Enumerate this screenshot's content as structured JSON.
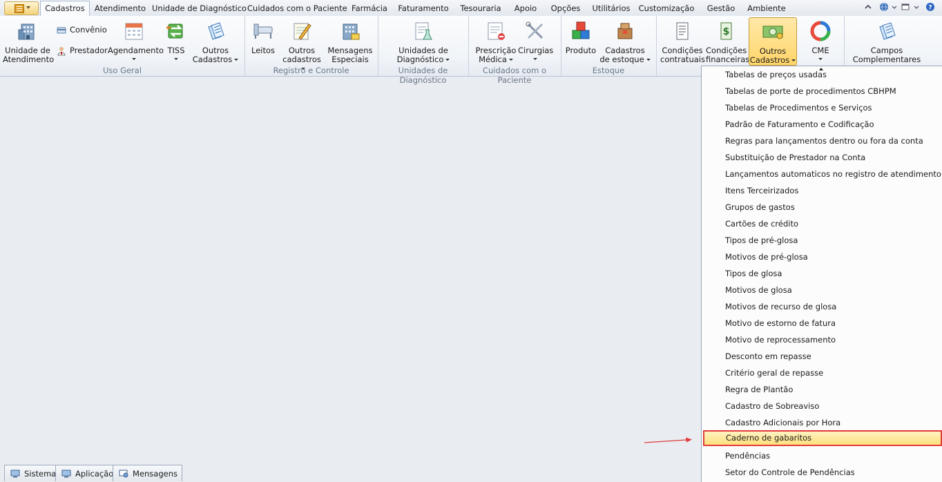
{
  "menu_tabs": [
    {
      "label": "Cadastros",
      "active": true
    },
    {
      "label": "Atendimento"
    },
    {
      "label": "Unidade de Diagnóstico"
    },
    {
      "label": "Cuidados com o Paciente"
    },
    {
      "label": "Farmácia"
    },
    {
      "label": "Faturamento"
    },
    {
      "label": "Tesouraria"
    },
    {
      "label": "Apoio"
    },
    {
      "label": "Opções"
    },
    {
      "label": "Utilitários"
    },
    {
      "label": "Customização"
    },
    {
      "label": "Gestão"
    },
    {
      "label": "Ambiente"
    }
  ],
  "ribbon": {
    "uso_geral": {
      "group_label": "Uso Geral",
      "unidade_atendimento": "Unidade de\nAtendimento",
      "convenio": "Convênio",
      "prestador": "Prestador",
      "agendamento": "Agendamento",
      "tiss": "TISS",
      "outros_cadastros": "Outros\nCadastros"
    },
    "registro_controle": {
      "group_label": "Registro e Controle",
      "leitos": "Leitos",
      "outros_cadastros": "Outros\ncadastros",
      "mensagens": "Mensagens\nEspeciais"
    },
    "unidades_diag": {
      "group_label": "Unidades de Diagnóstico",
      "unidades": "Unidades de\nDiagnóstico"
    },
    "cuidados": {
      "group_label": "Cuidados com o Paciente",
      "prescricao": "Prescrição\nMédica",
      "cirurgias": "Cirurgias"
    },
    "estoque": {
      "group_label": "Estoque",
      "produto": "Produto",
      "cadastros_estoque": "Cadastros\nde estoque"
    },
    "financeiro": {
      "condicoes_contratuais": "Condições\ncontratuais",
      "condicoes_financeiras": "Condições\nfinanceiras",
      "outros_cadastros": "Outros\nCadastros",
      "cme": "CME",
      "campos": "Campos\nComplementares"
    }
  },
  "dropdown": {
    "items": [
      "Tabelas de preços usadas",
      "Tabelas de porte de procedimentos CBHPM",
      "Tabelas de Procedimentos e Serviços",
      "Padrão de Faturamento e Codificação",
      "Regras para lançamentos dentro ou fora da conta",
      "Substituição de Prestador na Conta",
      "Lançamentos automaticos no registro de atendimento",
      "Itens Terceirizados",
      "Grupos de gastos",
      "Cartões de crédito",
      "Tipos de pré-glosa",
      "Motivos de pré-glosa",
      "Tipos de glosa",
      "Motivos de glosa",
      "Motivos de recurso de glosa",
      "Motivo de estorno de fatura",
      "Motivo de reprocessamento",
      "Desconto em repasse",
      "Critério geral de repasse",
      "Regra de Plantão",
      "Cadastro de Sobreaviso",
      "Cadastro Adicionais por Hora",
      "Caderno de gabaritos",
      "Pendências",
      "Setor do Controle de Pendências"
    ],
    "highlighted_index": 22
  },
  "bottom_tabs": [
    "Sistema",
    "Aplicação",
    "Mensagens"
  ],
  "colors": {
    "highlight_border": "#e03a3a",
    "selected_fill": "#ffd56a",
    "workspace": "#e9ecf0"
  }
}
